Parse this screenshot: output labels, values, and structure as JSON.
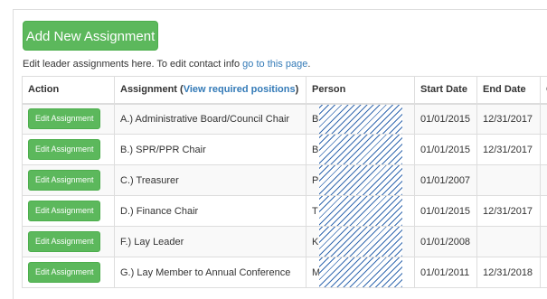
{
  "add_button_label": "Add New Assignment",
  "info": {
    "text": "Edit leader assignments here. To edit contact info ",
    "link": "go to this page",
    "end": "."
  },
  "table": {
    "headers": {
      "action": "Action",
      "assignment": "Assignment (",
      "assignment_link": "View required positions",
      "assignment_end": ")",
      "person": "Person",
      "start": "Start Date",
      "end": "End Date",
      "extra": "C"
    },
    "edit_label": "Edit Assignment",
    "rows": [
      {
        "assignment": "A.) Administrative Board/Council Chair",
        "person_initial": "B",
        "start": "01/01/2015",
        "end": "12/31/2017"
      },
      {
        "assignment": "B.) SPR/PPR Chair",
        "person_initial": "B",
        "start": "01/01/2015",
        "end": "12/31/2017"
      },
      {
        "assignment": "C.) Treasurer",
        "person_initial": "P",
        "start": "01/01/2007",
        "end": ""
      },
      {
        "assignment": "D.) Finance Chair",
        "person_initial": "T",
        "start": "01/01/2015",
        "end": "12/31/2017"
      },
      {
        "assignment": "F.) Lay Leader",
        "person_initial": "K",
        "start": "01/01/2008",
        "end": ""
      },
      {
        "assignment": "G.) Lay Member to Annual Conference",
        "person_initial": "M",
        "start": "01/01/2011",
        "end": "12/31/2018"
      }
    ]
  }
}
